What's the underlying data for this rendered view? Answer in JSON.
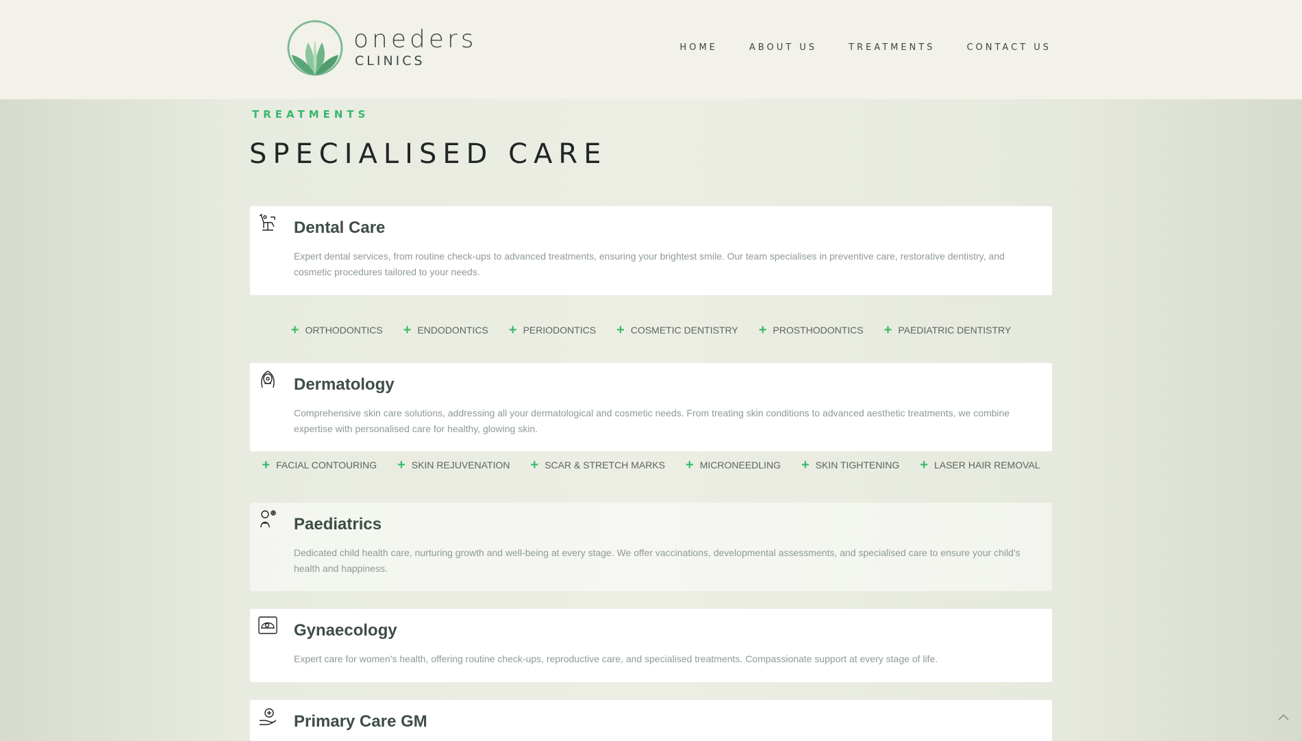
{
  "header": {
    "logo_word": "oneders",
    "logo_sub": "CLINICS",
    "nav": [
      "HOME",
      "ABOUT US",
      "TREATMENTS",
      "CONTACT US"
    ]
  },
  "section": {
    "eyebrow": "TREATMENTS",
    "title": "SPECIALISED CARE"
  },
  "cards": [
    {
      "title": "Dental Care",
      "icon": "dental-chair-icon",
      "desc": "Expert dental services, from routine check-ups to advanced treatments, ensuring your brightest smile. Our team specialises in preventive care, restorative dentistry, and cosmetic procedures tailored to your needs.",
      "tags": [
        "ORTHODONTICS",
        "ENDODONTICS",
        "PERIODONTICS",
        "COSMETIC DENTISTRY",
        "PROSTHODONTICS",
        "PAEDIATRIC DENTISTRY"
      ]
    },
    {
      "title": "Dermatology",
      "icon": "face-skin-icon",
      "desc": "Comprehensive skin care solutions, addressing all your dermatological and cosmetic needs. From treating skin conditions to advanced aesthetic treatments, we combine expertise with personalised care for healthy, glowing skin.",
      "tags": [
        "FACIAL CONTOURING",
        "SKIN REJUVENATION",
        "SCAR & STRETCH MARKS",
        "MICRONEEDLING",
        "SKIN TIGHTENING",
        "LASER HAIR REMOVAL"
      ]
    },
    {
      "title": "Paediatrics",
      "icon": "child-icon",
      "desc": "Dedicated child health care, nurturing growth and well-being at every stage. We offer vaccinations, developmental assessments, and specialised care to ensure your child's health and happiness."
    },
    {
      "title": "Gynaecology",
      "icon": "ultrasound-icon",
      "desc": "Expert care for women's health, offering routine check-ups, reproductive care, and specialised treatments. Compassionate support at every stage of life."
    },
    {
      "title": "Primary Care GM",
      "icon": "hand-care-icon"
    }
  ],
  "colors": {
    "accent": "#35b86b",
    "heading": "#3e4c48",
    "text": "#8e9a94"
  }
}
